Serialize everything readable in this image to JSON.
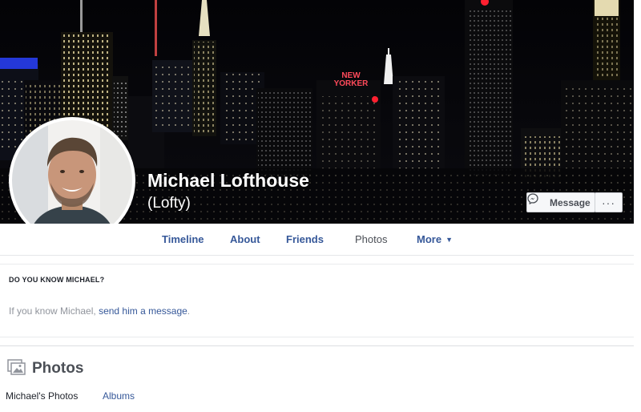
{
  "profile": {
    "name": "Michael Lofthouse",
    "nickname": "(Lofty)"
  },
  "cover_signs": {
    "line1": "NEW",
    "line2": "YORKER"
  },
  "actions": {
    "message_label": "Message",
    "more_label": "···"
  },
  "nav": {
    "items": [
      {
        "label": "Timeline"
      },
      {
        "label": "About"
      },
      {
        "label": "Friends"
      },
      {
        "label": "Photos",
        "active": true
      },
      {
        "label": "More"
      }
    ],
    "more_caret": "▼"
  },
  "know": {
    "title": "DO YOU KNOW MICHAEL?",
    "text_prefix": "If you know Michael,",
    "link_text": "send him a message",
    "text_suffix": "."
  },
  "photos": {
    "title": "Photos",
    "tabs": [
      {
        "label": "Michael's Photos"
      },
      {
        "label": "Albums"
      }
    ]
  },
  "colors": {
    "link": "#365899",
    "muted": "#90949c",
    "dark": "#4b4f56"
  }
}
